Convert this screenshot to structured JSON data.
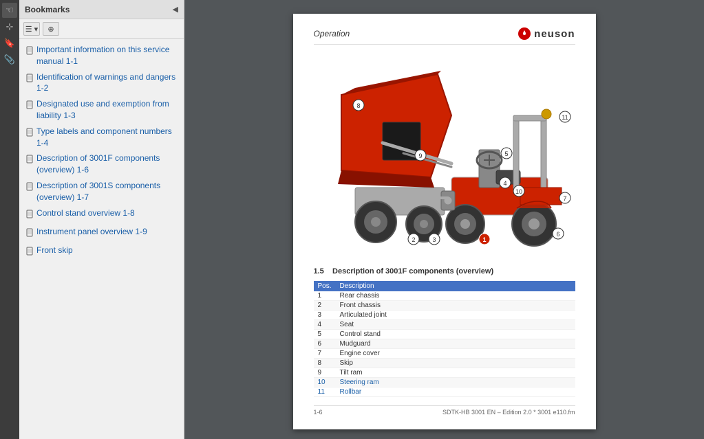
{
  "toolbar": {
    "icons": [
      "☰",
      "◎",
      "✉",
      "🔖",
      "🔗"
    ]
  },
  "bookmarks_panel": {
    "title": "Bookmarks",
    "close_icon": "◀",
    "toolbar_btn1": "☰▾",
    "toolbar_btn2": "⊕",
    "items": [
      {
        "label": "Important information on this service manual 1-1",
        "icon": "🔖"
      },
      {
        "label": "Identification of warnings and dangers 1-2",
        "icon": "🔖"
      },
      {
        "label": "Designated use and exemption from liability 1-3",
        "icon": "🔖"
      },
      {
        "label": "Type labels and component numbers 1-4",
        "icon": "🔖"
      },
      {
        "label": "Description of 3001F components (overview) 1-6",
        "icon": "🔖"
      },
      {
        "label": "Description of 3001S components (overview) 1-7",
        "icon": "🔖"
      },
      {
        "label": "Control stand overview 1-8",
        "icon": "🔖"
      },
      {
        "label": "Instrument panel overview 1-9",
        "icon": "🔖"
      },
      {
        "label": "Front skip",
        "icon": "🔖"
      }
    ]
  },
  "document": {
    "header": {
      "title": "Operation",
      "logo_text": "neuson"
    },
    "section": {
      "number": "1.5",
      "title": "Description of 3001F components (overview)"
    },
    "table": {
      "col_pos": "Pos.",
      "col_desc": "Description",
      "rows": [
        {
          "pos": "1",
          "desc": "Rear chassis"
        },
        {
          "pos": "2",
          "desc": "Front chassis"
        },
        {
          "pos": "3",
          "desc": "Articulated joint"
        },
        {
          "pos": "4",
          "desc": "Seat"
        },
        {
          "pos": "5",
          "desc": "Control stand"
        },
        {
          "pos": "6",
          "desc": "Mudguard"
        },
        {
          "pos": "7",
          "desc": "Engine cover"
        },
        {
          "pos": "8",
          "desc": "Skip"
        },
        {
          "pos": "9",
          "desc": "Tilt ram"
        },
        {
          "pos": "10",
          "desc": "Steering ram"
        },
        {
          "pos": "11",
          "desc": "Rollbar"
        }
      ]
    },
    "footer": {
      "page_num": "1-6",
      "doc_ref": "SDTK-HB 3001 EN – Edition 2.0 * 3001 e110.fm"
    }
  }
}
